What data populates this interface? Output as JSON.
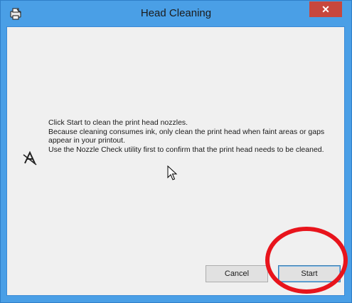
{
  "window": {
    "title": "Head Cleaning",
    "close_glyph": "✕"
  },
  "message": {
    "line1": "Click Start to clean the print head nozzles.",
    "line2": "Because cleaning consumes ink, only clean the print head when faint areas or gaps appear in your printout.",
    "line3": "Use the Nozzle Check utility first to confirm that the print head needs to be cleaned."
  },
  "buttons": {
    "cancel_label": "Cancel",
    "start_label": "Start"
  },
  "icons": {
    "app": "printer-icon",
    "info": "print-head-icon",
    "cursor": "mouse-pointer-icon"
  },
  "colors": {
    "titlebar": "#4a9fe6",
    "close_button": "#c7473d",
    "client_background": "#f0f0f0",
    "highlight": "#e8141c"
  }
}
